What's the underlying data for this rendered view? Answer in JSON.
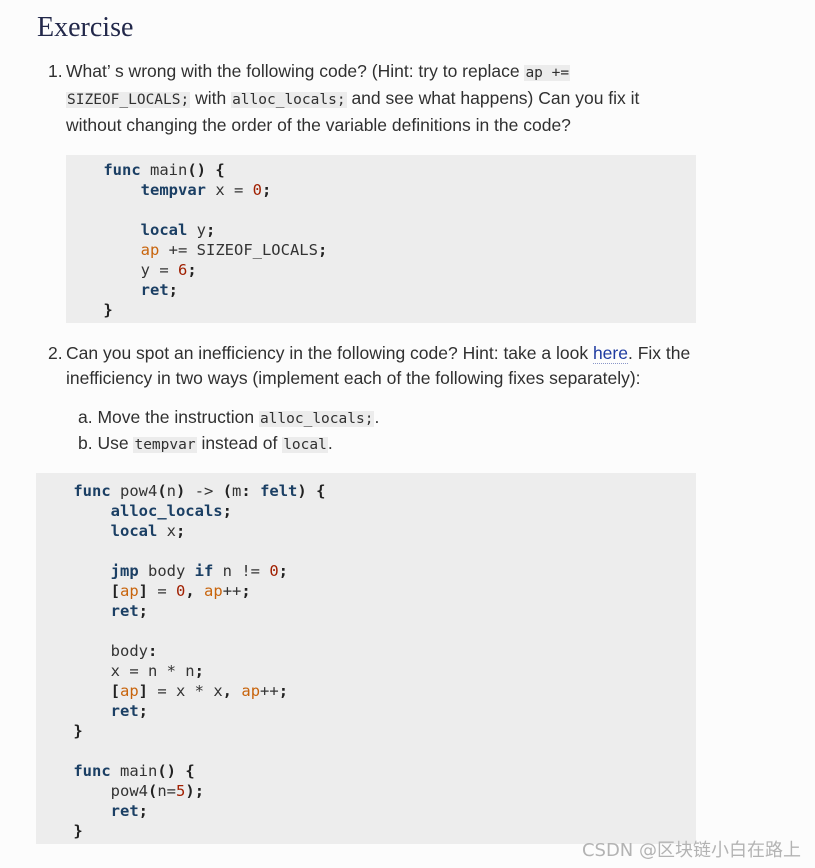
{
  "title": "Exercise",
  "q1": {
    "num": "1.",
    "t1": "What’ s wrong with the following code? (Hint: try to replace ",
    "c1": "ap +=",
    "c2": "SIZEOF_LOCALS;",
    "t2": " with ",
    "c3": "alloc_locals;",
    "t3": " and see what happens) Can you fix it without changing the order of the variable definitions in the code?"
  },
  "code1": [
    "    func main() {",
    "        tempvar x = 0;",
    "",
    "        local y;",
    "        ap += SIZEOF_LOCALS;",
    "        y = 6;",
    "        ret;",
    "    }"
  ],
  "q2": {
    "num": "2.",
    "t1": "Can you spot an inefficiency in the following code? Hint: take a look ",
    "link": "here",
    "t2": ". Fix the inefficiency in two ways (implement each of the following fixes separately):"
  },
  "sub": {
    "a_label": "a.",
    "a_t1": "Move the instruction ",
    "a_code": "alloc_locals;",
    "a_t2": ".",
    "b_label": "b.",
    "b_t1": "Use ",
    "b_code1": "tempvar",
    "b_t2": " instead of ",
    "b_code2": "local",
    "b_t3": "."
  },
  "code2": [
    "    func pow4(n) -> (m: felt) {",
    "        alloc_locals;",
    "        local x;",
    "",
    "        jmp body if n != 0;",
    "        [ap] = 0, ap++;",
    "        ret;",
    "",
    "        body:",
    "        x = n * n;",
    "        [ap] = x * x, ap++;",
    "        ret;",
    "    }",
    "",
    "    func main() {",
    "        pow4(n=5);",
    "        ret;",
    "    }"
  ],
  "watermark": "CSDN @区块链小白在路上"
}
